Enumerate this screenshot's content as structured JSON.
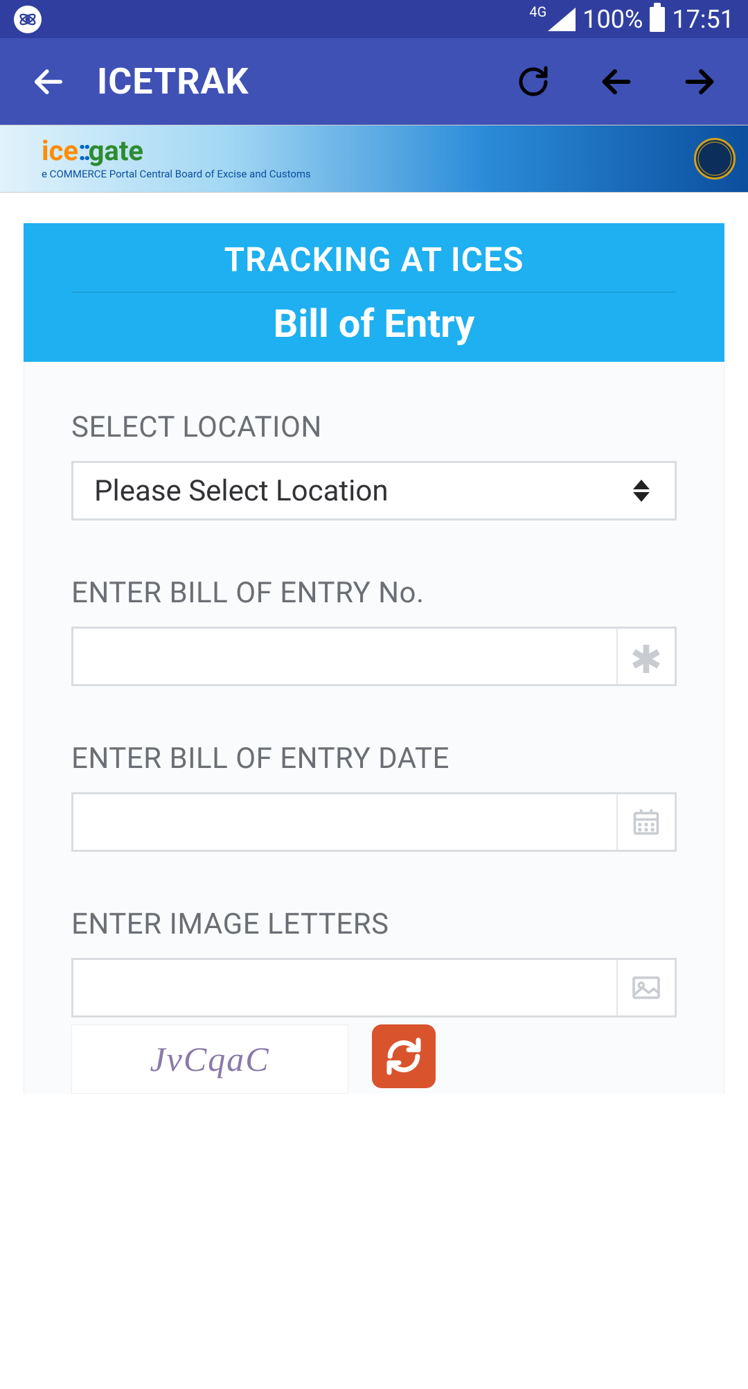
{
  "status_bar": {
    "network_label": "4G",
    "battery_percent": "100%",
    "time": "17:51"
  },
  "app_bar": {
    "title": "ICETRAK"
  },
  "banner": {
    "logo_ice": "ice",
    "logo_dots": "::",
    "logo_gate": "gate",
    "subtitle": "e COMMERCE Portal Central Board of Excise and Customs"
  },
  "heading": {
    "title": "TRACKING AT ICES",
    "subtitle": "Bill of Entry"
  },
  "form": {
    "location": {
      "label": "SELECT LOCATION",
      "selected": "Please Select Location"
    },
    "be_no": {
      "label": "ENTER BILL OF ENTRY No.",
      "value": ""
    },
    "be_date": {
      "label": "ENTER BILL OF ENTRY DATE",
      "value": ""
    },
    "captcha": {
      "label": "ENTER IMAGE LETTERS",
      "value": "",
      "image_text": "JvCqaC"
    }
  }
}
